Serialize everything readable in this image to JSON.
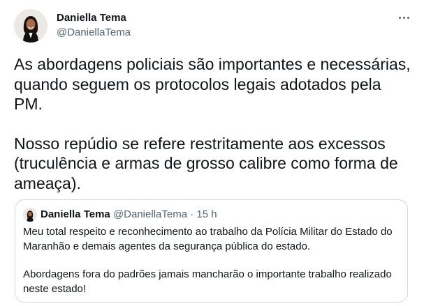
{
  "author": {
    "name": "Daniella Tema",
    "handle": "@DaniellaTema"
  },
  "tweet": {
    "paragraphs": [
      "As abordagens policiais são importantes e necessárias, quando seguem os protocolos legais adotados pela PM.",
      "Nosso repúdio se refere restritamente aos excessos (truculência e armas de grosso calibre como forma de ameaça)."
    ]
  },
  "quote": {
    "name": "Daniella Tema",
    "handle": "@DaniellaTema",
    "separator": "·",
    "time": "15 h",
    "paragraphs": [
      "Meu total respeito e reconhecimento ao trabalho da Polícia Militar do Estado do Maranhão e demais agentes da segurança pública do estado.",
      "Abordagens fora do padrões jamais mancharão o importante trabalho realizado neste estado!"
    ]
  },
  "icons": {
    "more": "more-dots-icon"
  }
}
